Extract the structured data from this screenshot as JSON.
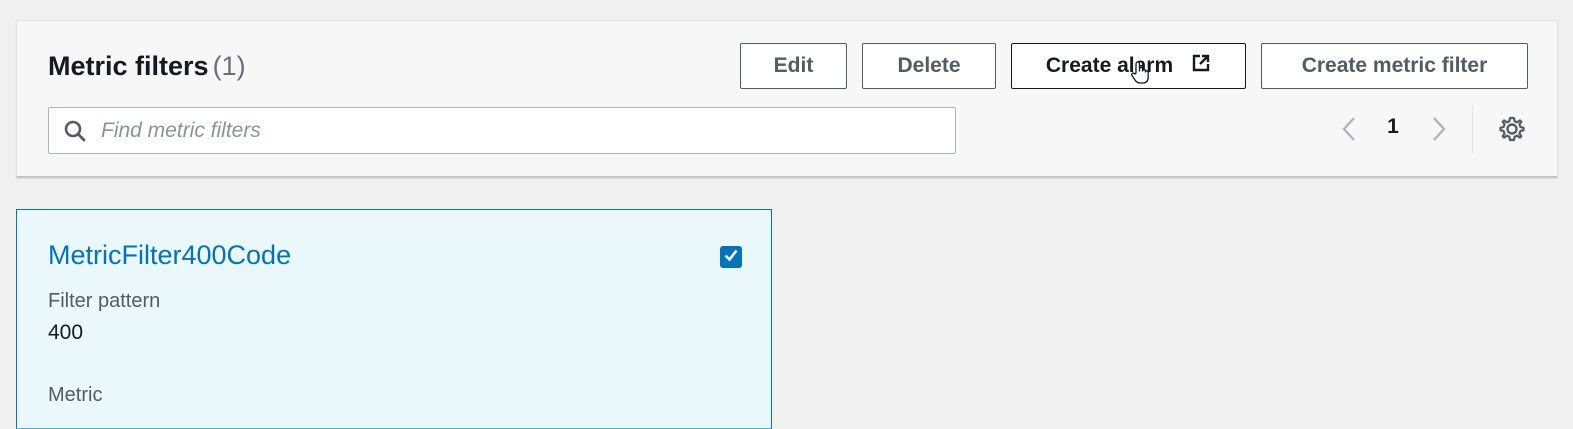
{
  "header": {
    "title": "Metric filters",
    "count": "(1)"
  },
  "toolbar": {
    "edit_label": "Edit",
    "delete_label": "Delete",
    "create_alarm_label": "Create alarm",
    "create_alarm_icon": "external-link-icon",
    "create_metric_filter_label": "Create metric filter"
  },
  "search": {
    "placeholder": "Find metric filters",
    "value": "",
    "icon": "search-icon"
  },
  "pagination": {
    "current_page": "1",
    "prev_icon": "chevron-left-icon",
    "next_icon": "chevron-right-icon",
    "settings_icon": "gear-icon"
  },
  "cards": [
    {
      "name": "MetricFilter400Code",
      "selected": true,
      "fields": [
        {
          "label": "Filter pattern",
          "value": "400"
        },
        {
          "label": "Metric",
          "value": ""
        }
      ]
    }
  ],
  "colors": {
    "link_blue": "#0073bb",
    "selected_card_bg": "#eaf8fc",
    "checkbox_fill": "#0073bb"
  }
}
